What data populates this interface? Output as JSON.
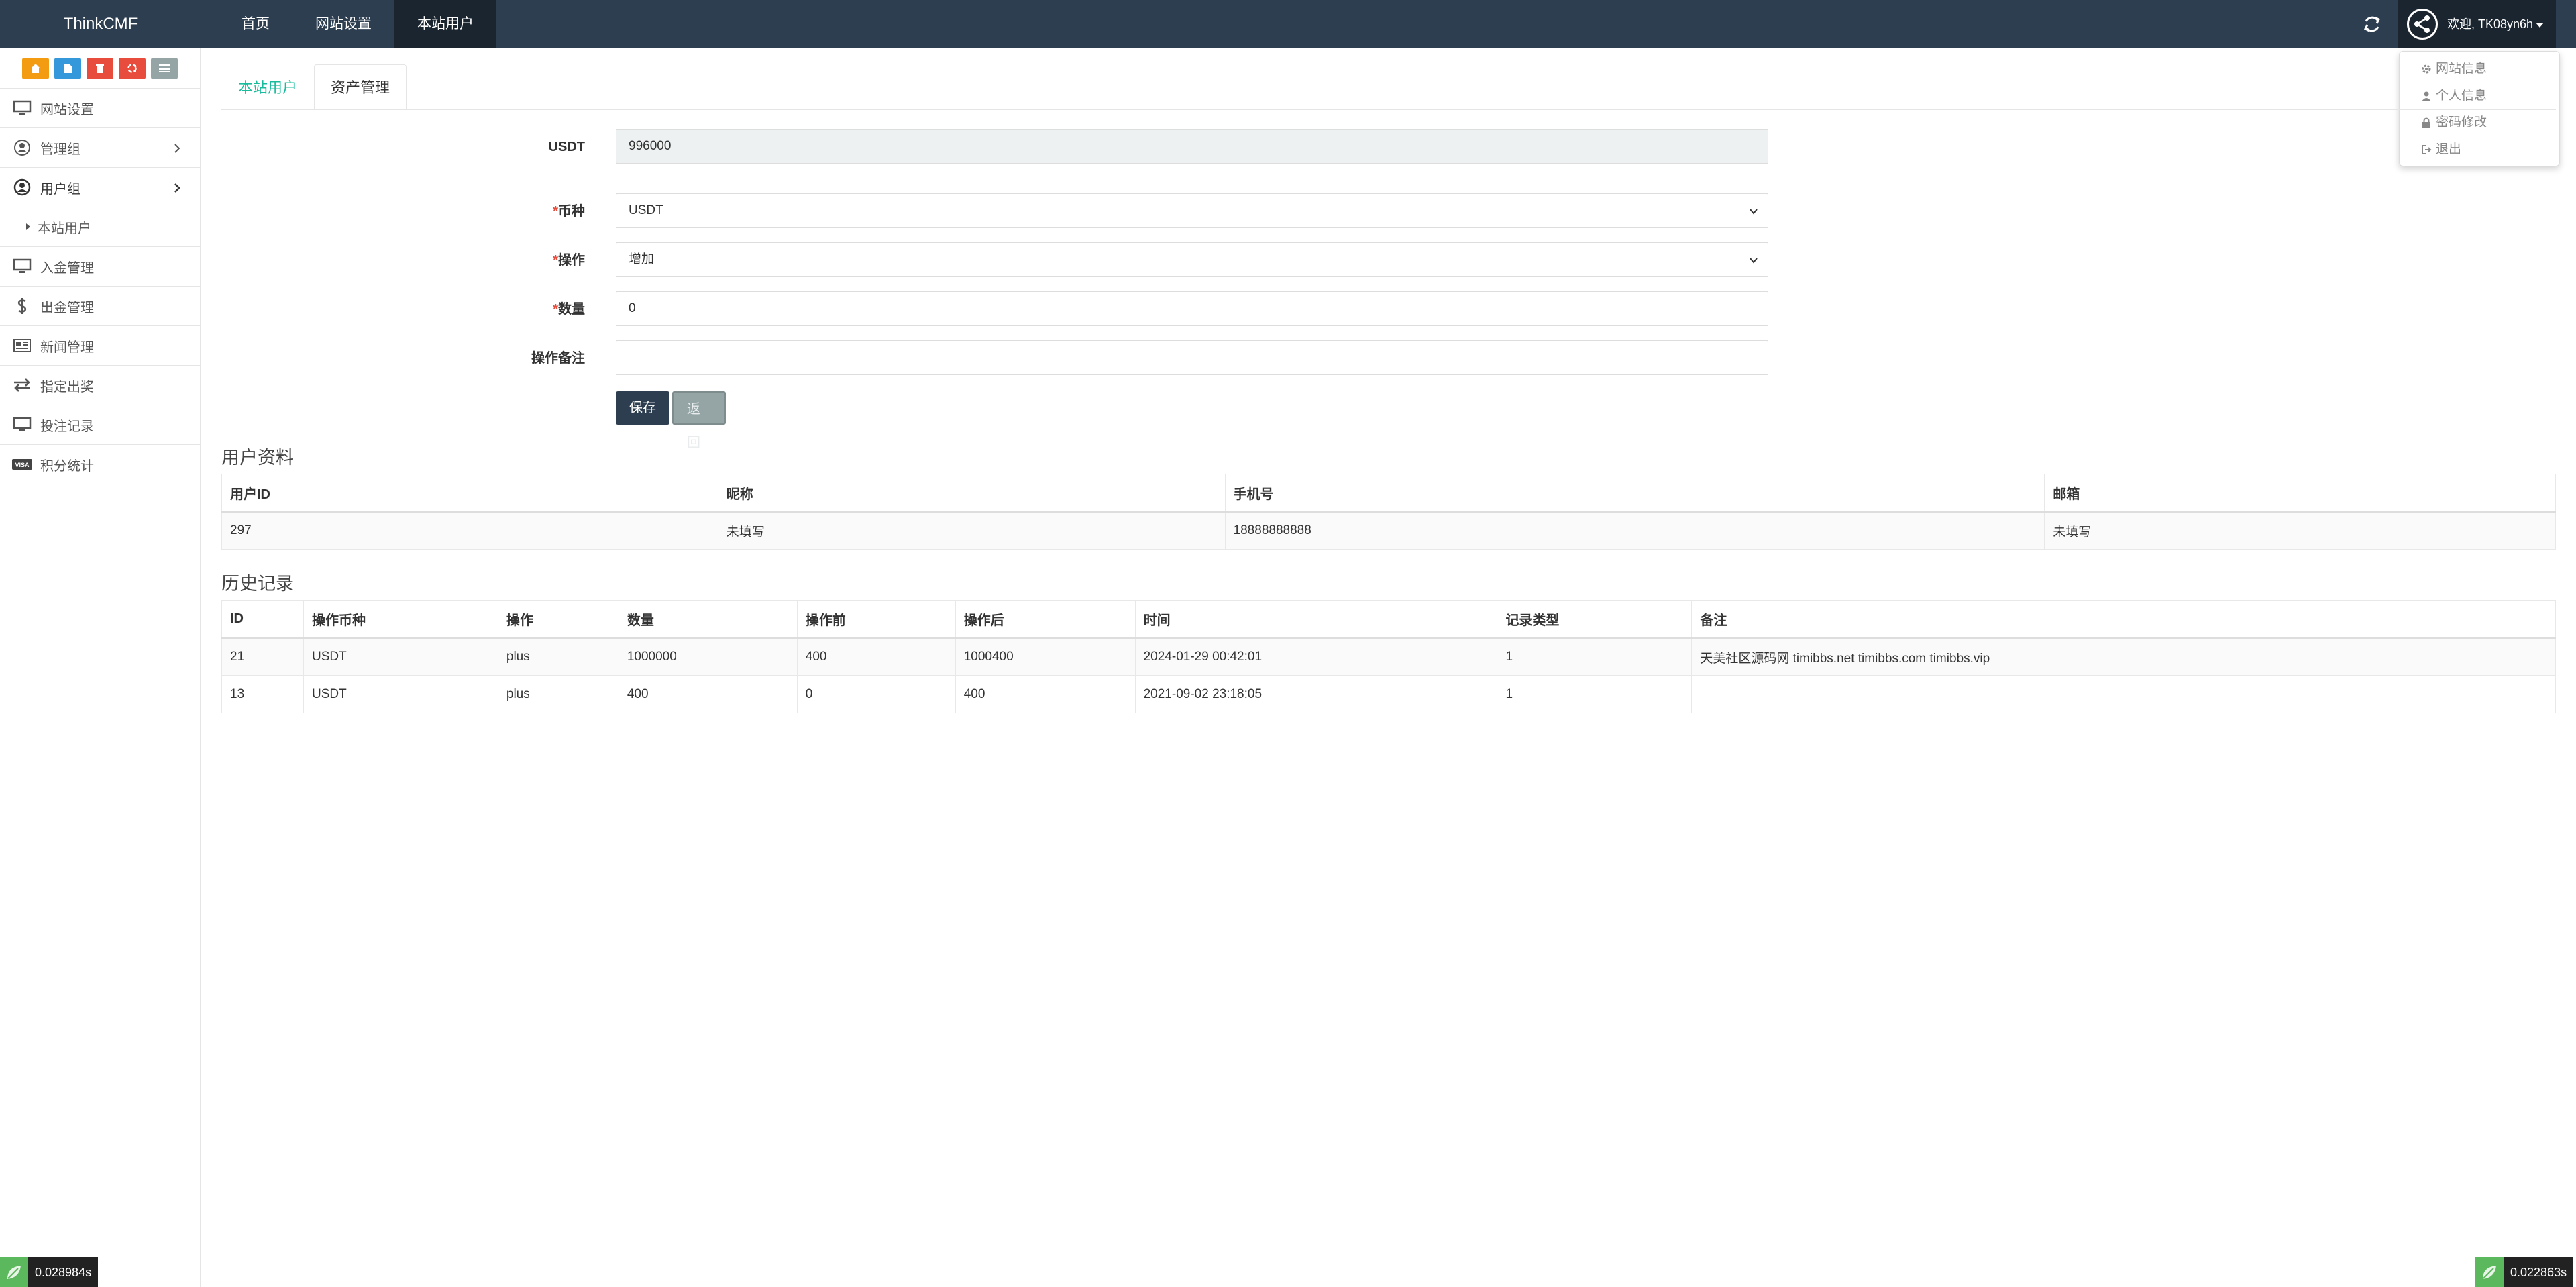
{
  "brand": "ThinkCMF",
  "topnav": [
    {
      "label": "首页",
      "active": false
    },
    {
      "label": "网站设置",
      "active": false
    },
    {
      "label": "本站用户",
      "active": true
    }
  ],
  "user": {
    "welcome": "欢迎, TK08yn6h"
  },
  "dropdown": {
    "items": [
      "网站信息",
      "个人信息",
      "密码修改",
      "退出"
    ]
  },
  "shortcut_colors": [
    "#f39c12",
    "#3498db",
    "#e74c3c",
    "#e74c3c",
    "#95a5a6"
  ],
  "sidebar": {
    "items": [
      {
        "label": "网站设置",
        "icon": "desktop-icon"
      },
      {
        "label": "管理组",
        "icon": "user-circle-icon"
      },
      {
        "label": "用户组",
        "icon": "user-circle-icon"
      },
      {
        "label": "本站用户",
        "icon": "caret-right-icon"
      },
      {
        "label": "入金管理",
        "icon": "desktop-icon"
      },
      {
        "label": "出金管理",
        "icon": "dollar-icon"
      },
      {
        "label": "新闻管理",
        "icon": "newspaper-icon"
      },
      {
        "label": "指定出奖",
        "icon": "exchange-icon"
      },
      {
        "label": "投注记录",
        "icon": "desktop-icon"
      },
      {
        "label": "积分统计",
        "icon": "visa-icon"
      }
    ]
  },
  "tabs": [
    {
      "label": "本站用户",
      "active": true
    },
    {
      "label": "资产管理",
      "active": false
    }
  ],
  "form": {
    "balance_label": "USDT",
    "balance_value": "996000",
    "currency_label": "币种",
    "currency_value": "USDT",
    "operation_label": "操作",
    "operation_value": "增加",
    "amount_label": "数量",
    "amount_value": "0",
    "remark_label": "操作备注",
    "remark_value": "",
    "required_mark": "*",
    "save_label": "保存",
    "back_label": "返回"
  },
  "profile": {
    "title": "用户资料",
    "headers": [
      "用户ID",
      "昵称",
      "手机号",
      "邮箱"
    ],
    "rows": [
      [
        "297",
        "未填写",
        "18888888888",
        "未填写"
      ]
    ]
  },
  "history": {
    "title": "历史记录",
    "headers": [
      "ID",
      "操作币种",
      "操作",
      "数量",
      "操作前",
      "操作后",
      "时间",
      "记录类型",
      "备注"
    ],
    "rows": [
      [
        "21",
        "USDT",
        "plus",
        "1000000",
        "400",
        "1000400",
        "2024-01-29 00:42:01",
        "1",
        "天美社区源码网 timibbs.net timibbs.com timibbs.vip"
      ],
      [
        "13",
        "USDT",
        "plus",
        "400",
        "0",
        "400",
        "2021-09-02 23:18:05",
        "1",
        ""
      ]
    ]
  },
  "timers": {
    "left": "0.028984s",
    "right": "0.022863s"
  },
  "colors": {
    "navbar": "#2c3e50",
    "accent": "#18bc9c",
    "required": "#e74c3c"
  }
}
